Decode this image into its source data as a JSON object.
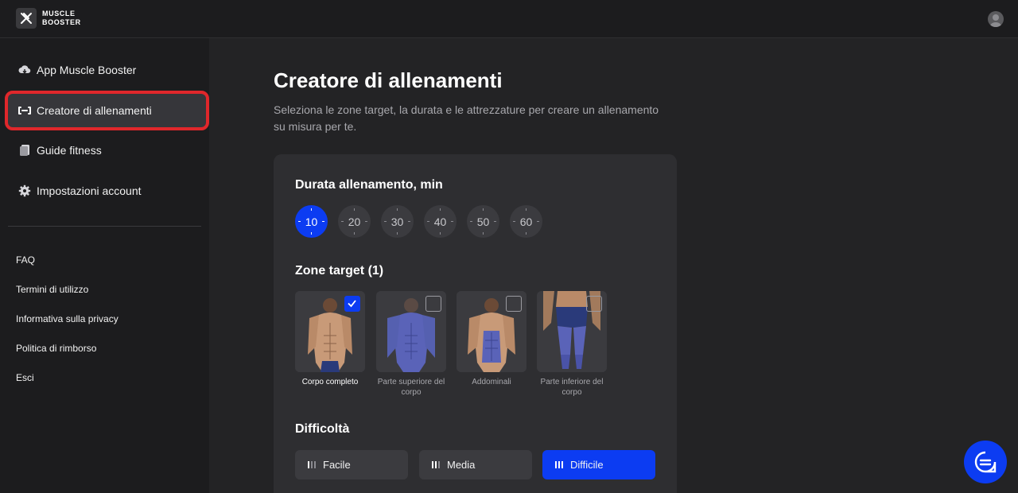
{
  "brand": {
    "line1": "MUSCLE",
    "line2": "BOOSTER"
  },
  "sidebar": {
    "items": [
      {
        "label": "App Muscle Booster",
        "icon": "download-cloud-icon"
      },
      {
        "label": "Creatore di allenamenti",
        "icon": "dumbbell-icon"
      },
      {
        "label": "Guide fitness",
        "icon": "book-icon"
      },
      {
        "label": "Impostazioni account",
        "icon": "gear-icon"
      }
    ],
    "links": [
      "FAQ",
      "Termini di utilizzo",
      "Informativa sulla privacy",
      "Politica di rimborso",
      "Esci"
    ]
  },
  "main": {
    "title": "Creatore di allenamenti",
    "subtitle": "Seleziona le zone target, la durata e le attrezzature per creare un allenamento su misura per te.",
    "duration": {
      "title": "Durata allenamento, min",
      "options": [
        "10",
        "20",
        "30",
        "40",
        "50",
        "60"
      ],
      "selected": "10"
    },
    "zones": {
      "title": "Zone target (1)",
      "items": [
        {
          "label": "Corpo completo",
          "checked": true
        },
        {
          "label": "Parte superiore del corpo",
          "checked": false
        },
        {
          "label": "Addominali",
          "checked": false
        },
        {
          "label": "Parte inferiore del corpo",
          "checked": false
        }
      ]
    },
    "difficulty": {
      "title": "Difficoltà",
      "options": [
        "Facile",
        "Media",
        "Difficile"
      ],
      "selected": "Difficile"
    }
  },
  "colors": {
    "accent": "#0c3cf2",
    "highlight": "#e0272b"
  }
}
